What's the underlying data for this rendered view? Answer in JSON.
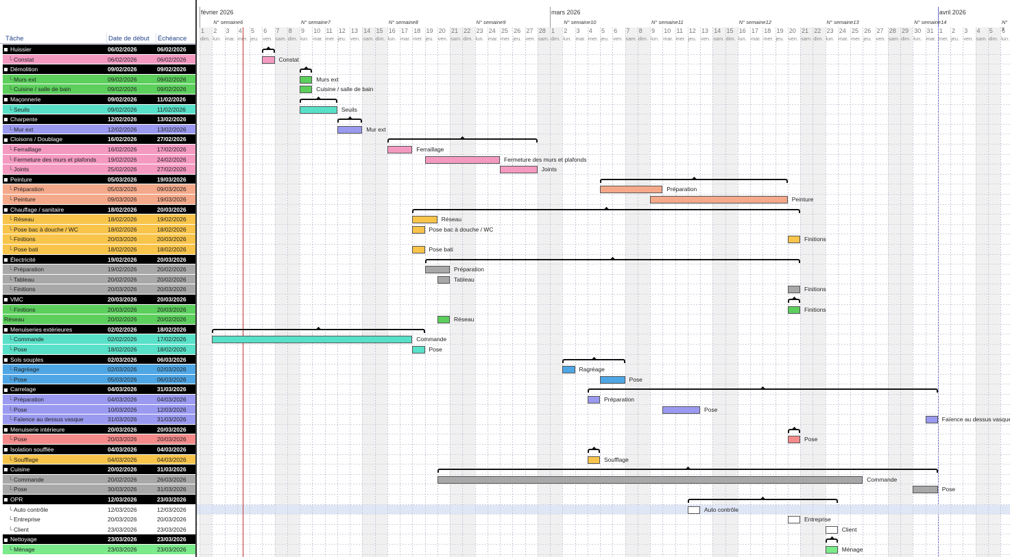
{
  "headers": {
    "task": "Tâche",
    "start": "Date de début",
    "end": "Échéance"
  },
  "months": [
    {
      "label": "février 2026",
      "day": 0
    },
    {
      "label": "mars 2026",
      "day": 28
    },
    {
      "label": "avril 2026",
      "day": 59
    }
  ],
  "weeks": [
    {
      "label": "N° semaine6",
      "day": 1
    },
    {
      "label": "N° semaine7",
      "day": 8
    },
    {
      "label": "N° semaine8",
      "day": 15
    },
    {
      "label": "N° semaine9",
      "day": 22
    },
    {
      "label": "N° semaine10",
      "day": 29
    },
    {
      "label": "N° semaine11",
      "day": 36
    },
    {
      "label": "N° semaine12",
      "day": 43
    },
    {
      "label": "N° semaine13",
      "day": 50
    },
    {
      "label": "N° semaine14",
      "day": 57
    },
    {
      "label": "N° s",
      "day": 64
    }
  ],
  "days": [
    "1",
    "2",
    "3",
    "4",
    "5",
    "6",
    "7",
    "8",
    "9",
    "10",
    "11",
    "12",
    "13",
    "14",
    "15",
    "16",
    "17",
    "18",
    "19",
    "20",
    "21",
    "22",
    "23",
    "24",
    "25",
    "26",
    "27",
    "28",
    "1",
    "2",
    "3",
    "4",
    "5",
    "6",
    "7",
    "8",
    "9",
    "10",
    "11",
    "12",
    "13",
    "14",
    "15",
    "16",
    "17",
    "18",
    "19",
    "20",
    "21",
    "22",
    "23",
    "24",
    "25",
    "26",
    "27",
    "28",
    "29",
    "30",
    "31",
    "1",
    "2",
    "3",
    "4",
    "5",
    "6"
  ],
  "daynames": [
    "dim.",
    "lun.",
    "mar.",
    "mer.",
    "jeu.",
    "ven.",
    "sam."
  ],
  "today_day": 3,
  "highlight_row": 46,
  "rows": [
    {
      "name": "Huissier",
      "start": "06/02/2026",
      "end": "06/02/2026",
      "group": true,
      "bg": "#000000",
      "bs": 5,
      "be": 6
    },
    {
      "name": "Constat",
      "start": "06/02/2026",
      "end": "06/02/2026",
      "bg": "#f49ac1",
      "bar": "#f49ac1",
      "bs": 5,
      "be": 6
    },
    {
      "name": "Démolition",
      "start": "09/02/2026",
      "end": "09/02/2026",
      "group": true,
      "bg": "#000000",
      "bs": 8,
      "be": 9
    },
    {
      "name": "Murs ext",
      "start": "09/02/2026",
      "end": "09/02/2026",
      "bg": "#5ccf5c",
      "bar": "#5ccf5c",
      "bs": 8,
      "be": 9
    },
    {
      "name": "Cuisine / salle de bain",
      "start": "09/02/2026",
      "end": "09/02/2026",
      "bg": "#5ccf5c",
      "bar": "#5ccf5c",
      "bs": 8,
      "be": 9
    },
    {
      "name": "Maçonnerie",
      "start": "09/02/2026",
      "end": "11/02/2026",
      "group": true,
      "bg": "#000000",
      "bs": 8,
      "be": 11
    },
    {
      "name": "Seuils",
      "start": "09/02/2026",
      "end": "11/02/2026",
      "bg": "#58e0c8",
      "bar": "#58e0c8",
      "bs": 8,
      "be": 11
    },
    {
      "name": "Charpente",
      "start": "12/02/2026",
      "end": "13/02/2026",
      "group": true,
      "bg": "#000000",
      "bs": 11,
      "be": 13
    },
    {
      "name": "Mur ext",
      "start": "12/02/2026",
      "end": "13/02/2026",
      "bg": "#9a9af0",
      "bar": "#9a9af0",
      "bs": 11,
      "be": 13
    },
    {
      "name": "Cloisons / Doublage",
      "start": "16/02/2026",
      "end": "27/02/2026",
      "group": true,
      "bg": "#000000",
      "bs": 15,
      "be": 27
    },
    {
      "name": "Ferraillage",
      "start": "16/02/2026",
      "end": "17/02/2026",
      "bg": "#f49ac1",
      "bar": "#f49ac1",
      "bs": 15,
      "be": 17
    },
    {
      "name": "Fermeture des murs et plafonds",
      "start": "19/02/2026",
      "end": "24/02/2026",
      "bg": "#f49ac1",
      "bar": "#f49ac1",
      "bs": 18,
      "be": 24
    },
    {
      "name": "Joints",
      "start": "25/02/2026",
      "end": "27/02/2026",
      "bg": "#f49ac1",
      "bar": "#f49ac1",
      "bs": 24,
      "be": 27
    },
    {
      "name": "Peinture",
      "start": "05/03/2026",
      "end": "19/03/2026",
      "group": true,
      "bg": "#000000",
      "bs": 32,
      "be": 47
    },
    {
      "name": "Préparation",
      "start": "05/03/2026",
      "end": "09/03/2026",
      "bg": "#f4a98a",
      "bar": "#f4a98a",
      "bs": 32,
      "be": 37
    },
    {
      "name": "Peinture",
      "start": "09/03/2026",
      "end": "19/03/2026",
      "bg": "#f4a98a",
      "bar": "#f4a98a",
      "bs": 36,
      "be": 47
    },
    {
      "name": "Chauffage / sanitaire",
      "start": "18/02/2026",
      "end": "20/03/2026",
      "group": true,
      "bg": "#000000",
      "bs": 17,
      "be": 48
    },
    {
      "name": "Réseau",
      "start": "18/02/2026",
      "end": "19/02/2026",
      "bg": "#f8c44a",
      "bar": "#f8c44a",
      "bs": 17,
      "be": 19
    },
    {
      "name": "Pose bac à douche / WC",
      "start": "18/02/2026",
      "end": "18/02/2026",
      "bg": "#f8c44a",
      "bar": "#f8c44a",
      "bs": 17,
      "be": 18
    },
    {
      "name": "Finitions",
      "start": "20/03/2026",
      "end": "20/03/2026",
      "bg": "#f8c44a",
      "bar": "#f8c44a",
      "bs": 47,
      "be": 48
    },
    {
      "name": "Pose bati",
      "start": "18/02/2026",
      "end": "18/02/2026",
      "bg": "#f8c44a",
      "bar": "#f8c44a",
      "bs": 17,
      "be": 18
    },
    {
      "name": "Électricité",
      "start": "19/02/2026",
      "end": "20/03/2026",
      "group": true,
      "bg": "#000000",
      "bs": 18,
      "be": 48
    },
    {
      "name": "Préparation",
      "start": "19/02/2026",
      "end": "20/02/2026",
      "bg": "#a8a8a8",
      "bar": "#a8a8a8",
      "bs": 18,
      "be": 20
    },
    {
      "name": "Tableau",
      "start": "20/02/2026",
      "end": "20/02/2026",
      "bg": "#a8a8a8",
      "bar": "#a8a8a8",
      "bs": 19,
      "be": 20
    },
    {
      "name": "Finitions",
      "start": "20/03/2026",
      "end": "20/03/2026",
      "bg": "#a8a8a8",
      "bar": "#a8a8a8",
      "bs": 47,
      "be": 48
    },
    {
      "name": "VMC",
      "start": "20/03/2026",
      "end": "20/03/2026",
      "group": true,
      "bg": "#000000",
      "bs": 47,
      "be": 48
    },
    {
      "name": "Finitions",
      "start": "20/03/2026",
      "end": "20/03/2026",
      "bg": "#5ccf5c",
      "bar": "#5ccf5c",
      "bs": 47,
      "be": 48
    },
    {
      "name": "Réseau",
      "start": "20/02/2026",
      "end": "20/02/2026",
      "bg": "#5ccf5c",
      "bar": "#5ccf5c",
      "bs": 19,
      "be": 20,
      "flat": true
    },
    {
      "name": "Menuiseries extérieures",
      "start": "02/02/2026",
      "end": "18/02/2026",
      "group": true,
      "bg": "#000000",
      "bs": 1,
      "be": 18
    },
    {
      "name": "Commande",
      "start": "02/02/2026",
      "end": "17/02/2026",
      "bg": "#58e0c8",
      "bar": "#58e0c8",
      "bs": 1,
      "be": 17
    },
    {
      "name": "Pose",
      "start": "18/02/2026",
      "end": "18/02/2026",
      "bg": "#58e0c8",
      "bar": "#58e0c8",
      "bs": 17,
      "be": 18
    },
    {
      "name": "Sols souples",
      "start": "02/03/2026",
      "end": "06/03/2026",
      "group": true,
      "bg": "#000000",
      "bs": 29,
      "be": 34
    },
    {
      "name": "Ragréage",
      "start": "02/03/2026",
      "end": "02/03/2026",
      "bg": "#4fa6e4",
      "bar": "#4fa6e4",
      "bs": 29,
      "be": 30
    },
    {
      "name": "Pose",
      "start": "05/03/2026",
      "end": "06/03/2026",
      "bg": "#4fa6e4",
      "bar": "#4fa6e4",
      "bs": 32,
      "be": 34
    },
    {
      "name": "Carrelage",
      "start": "04/03/2026",
      "end": "31/03/2026",
      "group": true,
      "bg": "#000000",
      "bs": 31,
      "be": 59
    },
    {
      "name": "Préparation",
      "start": "04/03/2026",
      "end": "04/03/2026",
      "bg": "#9a9af0",
      "bar": "#9a9af0",
      "bs": 31,
      "be": 32
    },
    {
      "name": "Pose",
      "start": "10/03/2026",
      "end": "12/03/2026",
      "bg": "#9a9af0",
      "bar": "#9a9af0",
      "bs": 37,
      "be": 40
    },
    {
      "name": "Faïence au dessus vasque",
      "start": "31/03/2026",
      "end": "31/03/2026",
      "bg": "#9a9af0",
      "bar": "#9a9af0",
      "bs": 58,
      "be": 59
    },
    {
      "name": "Menuiserie intérieure",
      "start": "20/03/2026",
      "end": "20/03/2026",
      "group": true,
      "bg": "#000000",
      "bs": 47,
      "be": 48
    },
    {
      "name": "Pose",
      "start": "20/03/2026",
      "end": "20/03/2026",
      "bg": "#f48a8a",
      "bar": "#f48a8a",
      "bs": 47,
      "be": 48
    },
    {
      "name": "Isolation soufflée",
      "start": "04/03/2026",
      "end": "04/03/2026",
      "group": true,
      "bg": "#000000",
      "bs": 31,
      "be": 32
    },
    {
      "name": "Soufflage",
      "start": "04/03/2026",
      "end": "04/03/2026",
      "bg": "#f8c44a",
      "bar": "#f8c44a",
      "bs": 31,
      "be": 32
    },
    {
      "name": "Cuisine",
      "start": "20/02/2026",
      "end": "31/03/2026",
      "group": true,
      "bg": "#000000",
      "bs": 19,
      "be": 59
    },
    {
      "name": "Commande",
      "start": "20/02/2026",
      "end": "26/03/2026",
      "bg": "#a8a8a8",
      "bar": "#a8a8a8",
      "bs": 19,
      "be": 53
    },
    {
      "name": "Pose",
      "start": "30/03/2026",
      "end": "31/03/2026",
      "bg": "#a8a8a8",
      "bar": "#a8a8a8",
      "bs": 57,
      "be": 59
    },
    {
      "name": "OPR",
      "start": "12/03/2026",
      "end": "23/03/2026",
      "group": true,
      "bg": "#000000",
      "bs": 39,
      "be": 51
    },
    {
      "name": "Auto contrôle",
      "start": "12/03/2026",
      "end": "12/03/2026",
      "bg": "#ffffff",
      "bar": "#ffffff",
      "bs": 39,
      "be": 40
    },
    {
      "name": "Entreprise",
      "start": "20/03/2026",
      "end": "20/03/2026",
      "bg": "#ffffff",
      "bar": "#ffffff",
      "bs": 47,
      "be": 48
    },
    {
      "name": "Client",
      "start": "23/03/2026",
      "end": "23/03/2026",
      "bg": "#ffffff",
      "bar": "#ffffff",
      "bs": 50,
      "be": 51
    },
    {
      "name": "Nettoyage",
      "start": "23/03/2026",
      "end": "23/03/2026",
      "group": true,
      "bg": "#000000",
      "bs": 50,
      "be": 51
    },
    {
      "name": "Ménage",
      "start": "23/03/2026",
      "end": "23/03/2026",
      "bg": "#7aea8a",
      "bar": "#7aea8a",
      "bs": 50,
      "be": 51
    }
  ]
}
